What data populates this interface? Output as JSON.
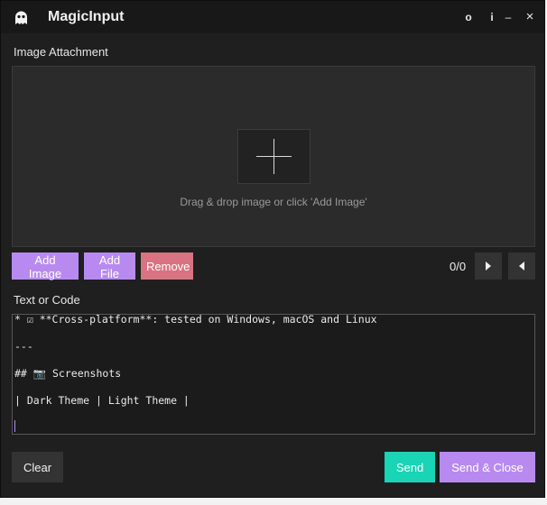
{
  "window": {
    "title": "MagicInput"
  },
  "titlebar": {
    "pin_glyph": "o",
    "info_glyph": "i",
    "minimize_glyph": "–",
    "close_glyph": "×"
  },
  "attachment": {
    "label": "Image Attachment",
    "drop_hint": "Drag & drop image or click 'Add Image'",
    "add_image": "Add Image",
    "add_file": "Add File",
    "remove": "Remove",
    "counter": "0/0"
  },
  "text": {
    "label": "Text or Code",
    "lines": [
      "* ☑ **Cross-platform**: tested on Windows, macOS and Linux",
      "",
      "---",
      "",
      "## 📷 Screenshots",
      "",
      "| Dark Theme | Light Theme |"
    ]
  },
  "footer": {
    "clear": "Clear",
    "send": "Send",
    "send_close": "Send & Close"
  },
  "colors": {
    "accent_purple": "#b88af0",
    "remove_red": "#d97381",
    "send_teal": "#19d4b5"
  },
  "icons": {
    "app": "ghost-icon",
    "next": "play-right-icon",
    "prev": "play-left-icon",
    "plus": "plus-icon"
  }
}
